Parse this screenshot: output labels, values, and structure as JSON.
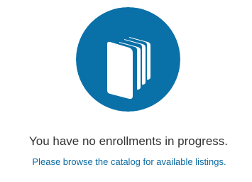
{
  "empty_state": {
    "icon": "books-icon",
    "icon_background_color": "#0a70a8",
    "icon_foreground_color": "#ffffff",
    "headline": "You have no enrollments in progress.",
    "link_text": "Please browse the catalog for available listings.",
    "link_color": "#0a6aa1",
    "headline_color": "#333333"
  }
}
